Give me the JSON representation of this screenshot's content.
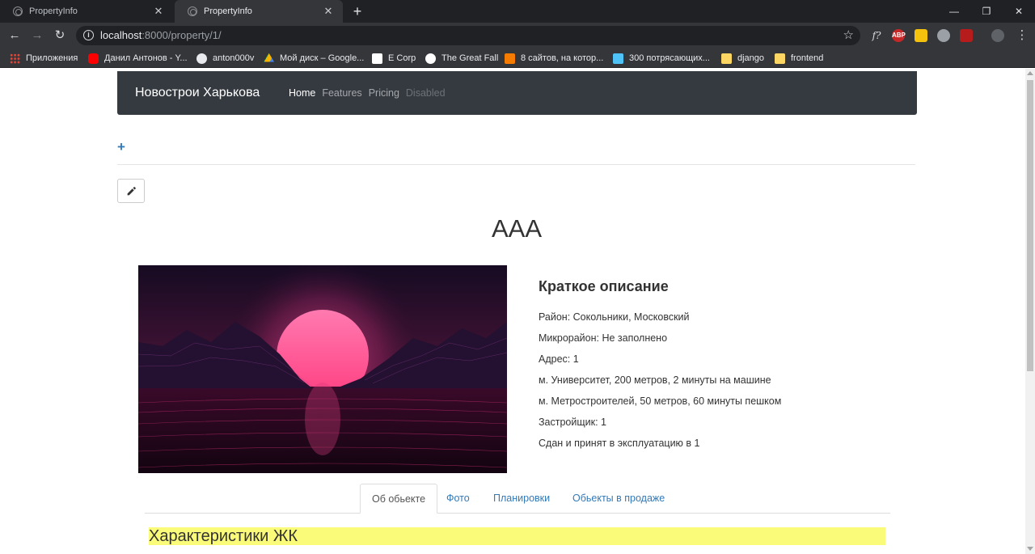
{
  "browser": {
    "tabs": [
      {
        "title": "PropertyInfo",
        "active": false
      },
      {
        "title": "PropertyInfo",
        "active": true
      }
    ],
    "url_host": "localhost",
    "url_rest": ":8000/property/1/",
    "bookmarks": [
      {
        "label": "Приложения",
        "icon": "apps-grid-icon"
      },
      {
        "label": "Данил Антонов - Y...",
        "icon": "youtube-icon"
      },
      {
        "label": "anton000v",
        "icon": "github-icon"
      },
      {
        "label": "Мой диск – Google...",
        "icon": "google-drive-icon"
      },
      {
        "label": "E Corp",
        "icon": "ecorp-icon"
      },
      {
        "label": "The Great Fall",
        "icon": "great-fall-icon"
      },
      {
        "label": "8 сайтов, на котор...",
        "icon": "site-icon"
      },
      {
        "label": "300 потрясающих...",
        "icon": "site-icon"
      },
      {
        "label": "django",
        "icon": "folder-icon"
      },
      {
        "label": "frontend",
        "icon": "folder-icon"
      }
    ],
    "extensions": {
      "abp": "ABP",
      "formula": "f?"
    }
  },
  "navbar": {
    "brand": "Новострои Харькова",
    "links": [
      {
        "label": "Home",
        "state": "active"
      },
      {
        "label": "Features",
        "state": "normal"
      },
      {
        "label": "Pricing",
        "state": "normal"
      },
      {
        "label": "Disabled",
        "state": "disabled"
      }
    ]
  },
  "actions": {
    "add": "+"
  },
  "property": {
    "title": "AAA",
    "description_heading": "Краткое описание",
    "details": [
      "Район: Сокольники, Московский",
      "Микрорайон: Не заполнено",
      "Адрес: 1",
      "м. Университет, 200 метров, 2 минуты на машине",
      "м. Метростроителей, 50 метров, 60 минуты пешком",
      "Застройщик: 1",
      "Сдан и принят в эксплуатацию в 1"
    ]
  },
  "tabs": [
    {
      "label": "Об обьекте",
      "active": true
    },
    {
      "label": "Фото",
      "active": false
    },
    {
      "label": "Планировки",
      "active": false
    },
    {
      "label": "Обьекты в продаже",
      "active": false
    }
  ],
  "section": {
    "title": "Характеристики ЖК"
  },
  "colors": {
    "navbar_bg": "#343a40",
    "link": "#337ab7",
    "highlight": "#fbfb7a"
  }
}
